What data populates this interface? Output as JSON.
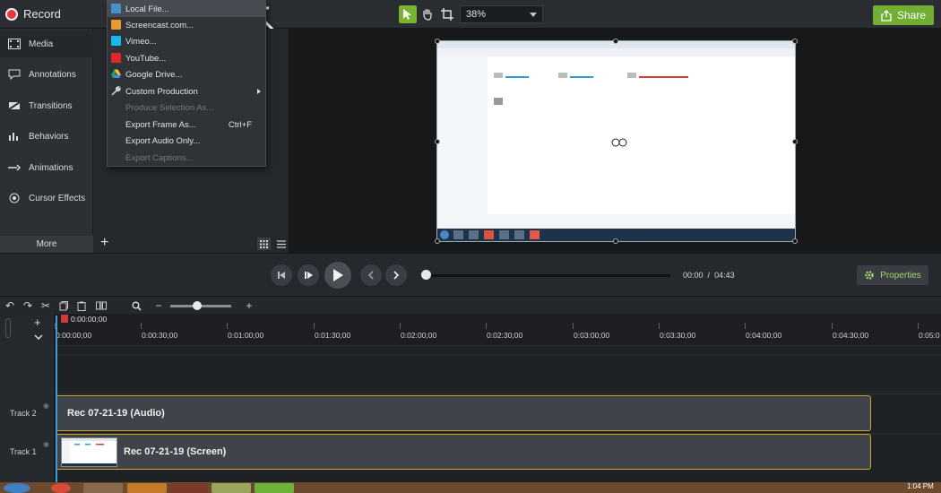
{
  "topbar": {
    "record_label": "Record",
    "zoom_value": "38%",
    "share_label": "Share"
  },
  "sidebar": {
    "items": [
      {
        "label": "Media",
        "icon": "film-icon"
      },
      {
        "label": "Annotations",
        "icon": "annotation-icon"
      },
      {
        "label": "Transitions",
        "icon": "transition-icon"
      },
      {
        "label": "Behaviors",
        "icon": "behavior-icon"
      },
      {
        "label": "Animations",
        "icon": "animation-icon"
      },
      {
        "label": "Cursor Effects",
        "icon": "cursor-effect-icon"
      }
    ],
    "more_label": "More"
  },
  "share_menu": {
    "items": [
      {
        "label": "Local File...",
        "icon_color": "#4a90c8"
      },
      {
        "label": "Screencast.com...",
        "icon_color": "#e89b2c"
      },
      {
        "label": "Vimeo...",
        "icon_color": "#1ab7ea"
      },
      {
        "label": "YouTube...",
        "icon_color": "#e0262b"
      },
      {
        "label": "Google Drive...",
        "icon_color": "#34a853"
      },
      {
        "label": "Custom Production"
      },
      {
        "label": "Produce Selection As..."
      },
      {
        "label": "Export Frame As...",
        "shortcut": "Ctrl+F"
      },
      {
        "label": "Export Audio Only..."
      },
      {
        "label": "Export Captions..."
      }
    ]
  },
  "playback": {
    "current_time": "00:00",
    "separator": "/",
    "total_time": "04:43",
    "properties_label": "Properties"
  },
  "timeline": {
    "playhead_time": "0:00:00;00",
    "ruler_ticks": [
      "0:00:00;00",
      "0:00:30;00",
      "0:01:00;00",
      "0:01:30;00",
      "0:02:00;00",
      "0:02:30;00",
      "0:03:00;00",
      "0:03:30;00",
      "0:04:00;00",
      "0:04:30;00",
      "0:05:0"
    ],
    "tracks": [
      {
        "label": "Track 2",
        "clip_title": "Rec 07-21-19 (Audio)"
      },
      {
        "label": "Track 1",
        "clip_title": "Rec 07-21-19 (Screen)"
      }
    ]
  },
  "taskbar": {
    "clock": "1:04 PM"
  },
  "colors": {
    "accent_green": "#72ad34",
    "record_red": "#e8373d",
    "clip_border": "#c9a227",
    "playhead_blue": "#3a9be0"
  }
}
